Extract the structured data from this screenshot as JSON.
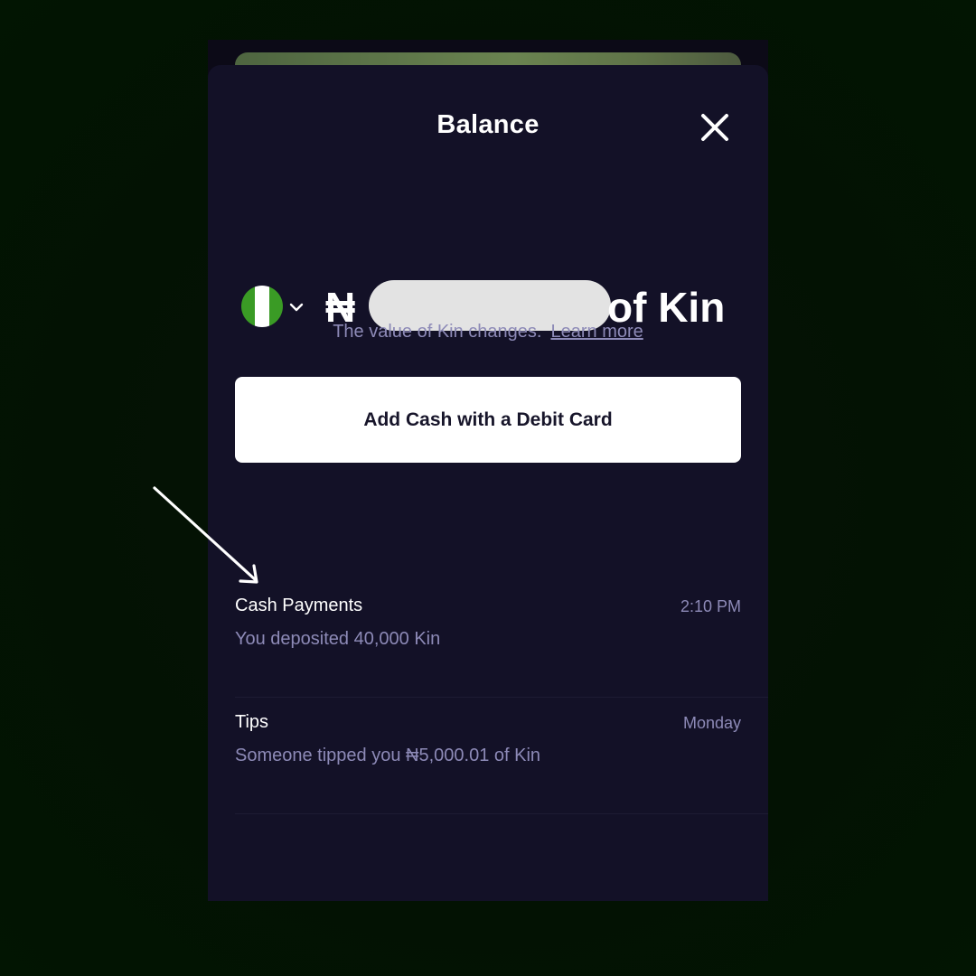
{
  "header": {
    "title": "Balance"
  },
  "balance": {
    "currency_symbol_visible": "₦",
    "amount_suffix": "of Kin",
    "flag": "nigeria-flag-icon"
  },
  "note": {
    "text": "The value of Kin changes.",
    "link": "Learn more"
  },
  "actions": {
    "add_cash_label": "Add Cash with a Debit Card"
  },
  "transactions": [
    {
      "title": "Cash Payments",
      "time": "2:10 PM",
      "description": "You deposited 40,000 Kin"
    },
    {
      "title": "Tips",
      "time": "Monday",
      "description": "Someone tipped you ₦5,000.01 of Kin"
    }
  ],
  "colors": {
    "background": "#031203",
    "sheet": "#131127",
    "muted_text": "#8d8ab7",
    "button_bg": "#ffffff",
    "flag_green": "#3a9b25"
  }
}
